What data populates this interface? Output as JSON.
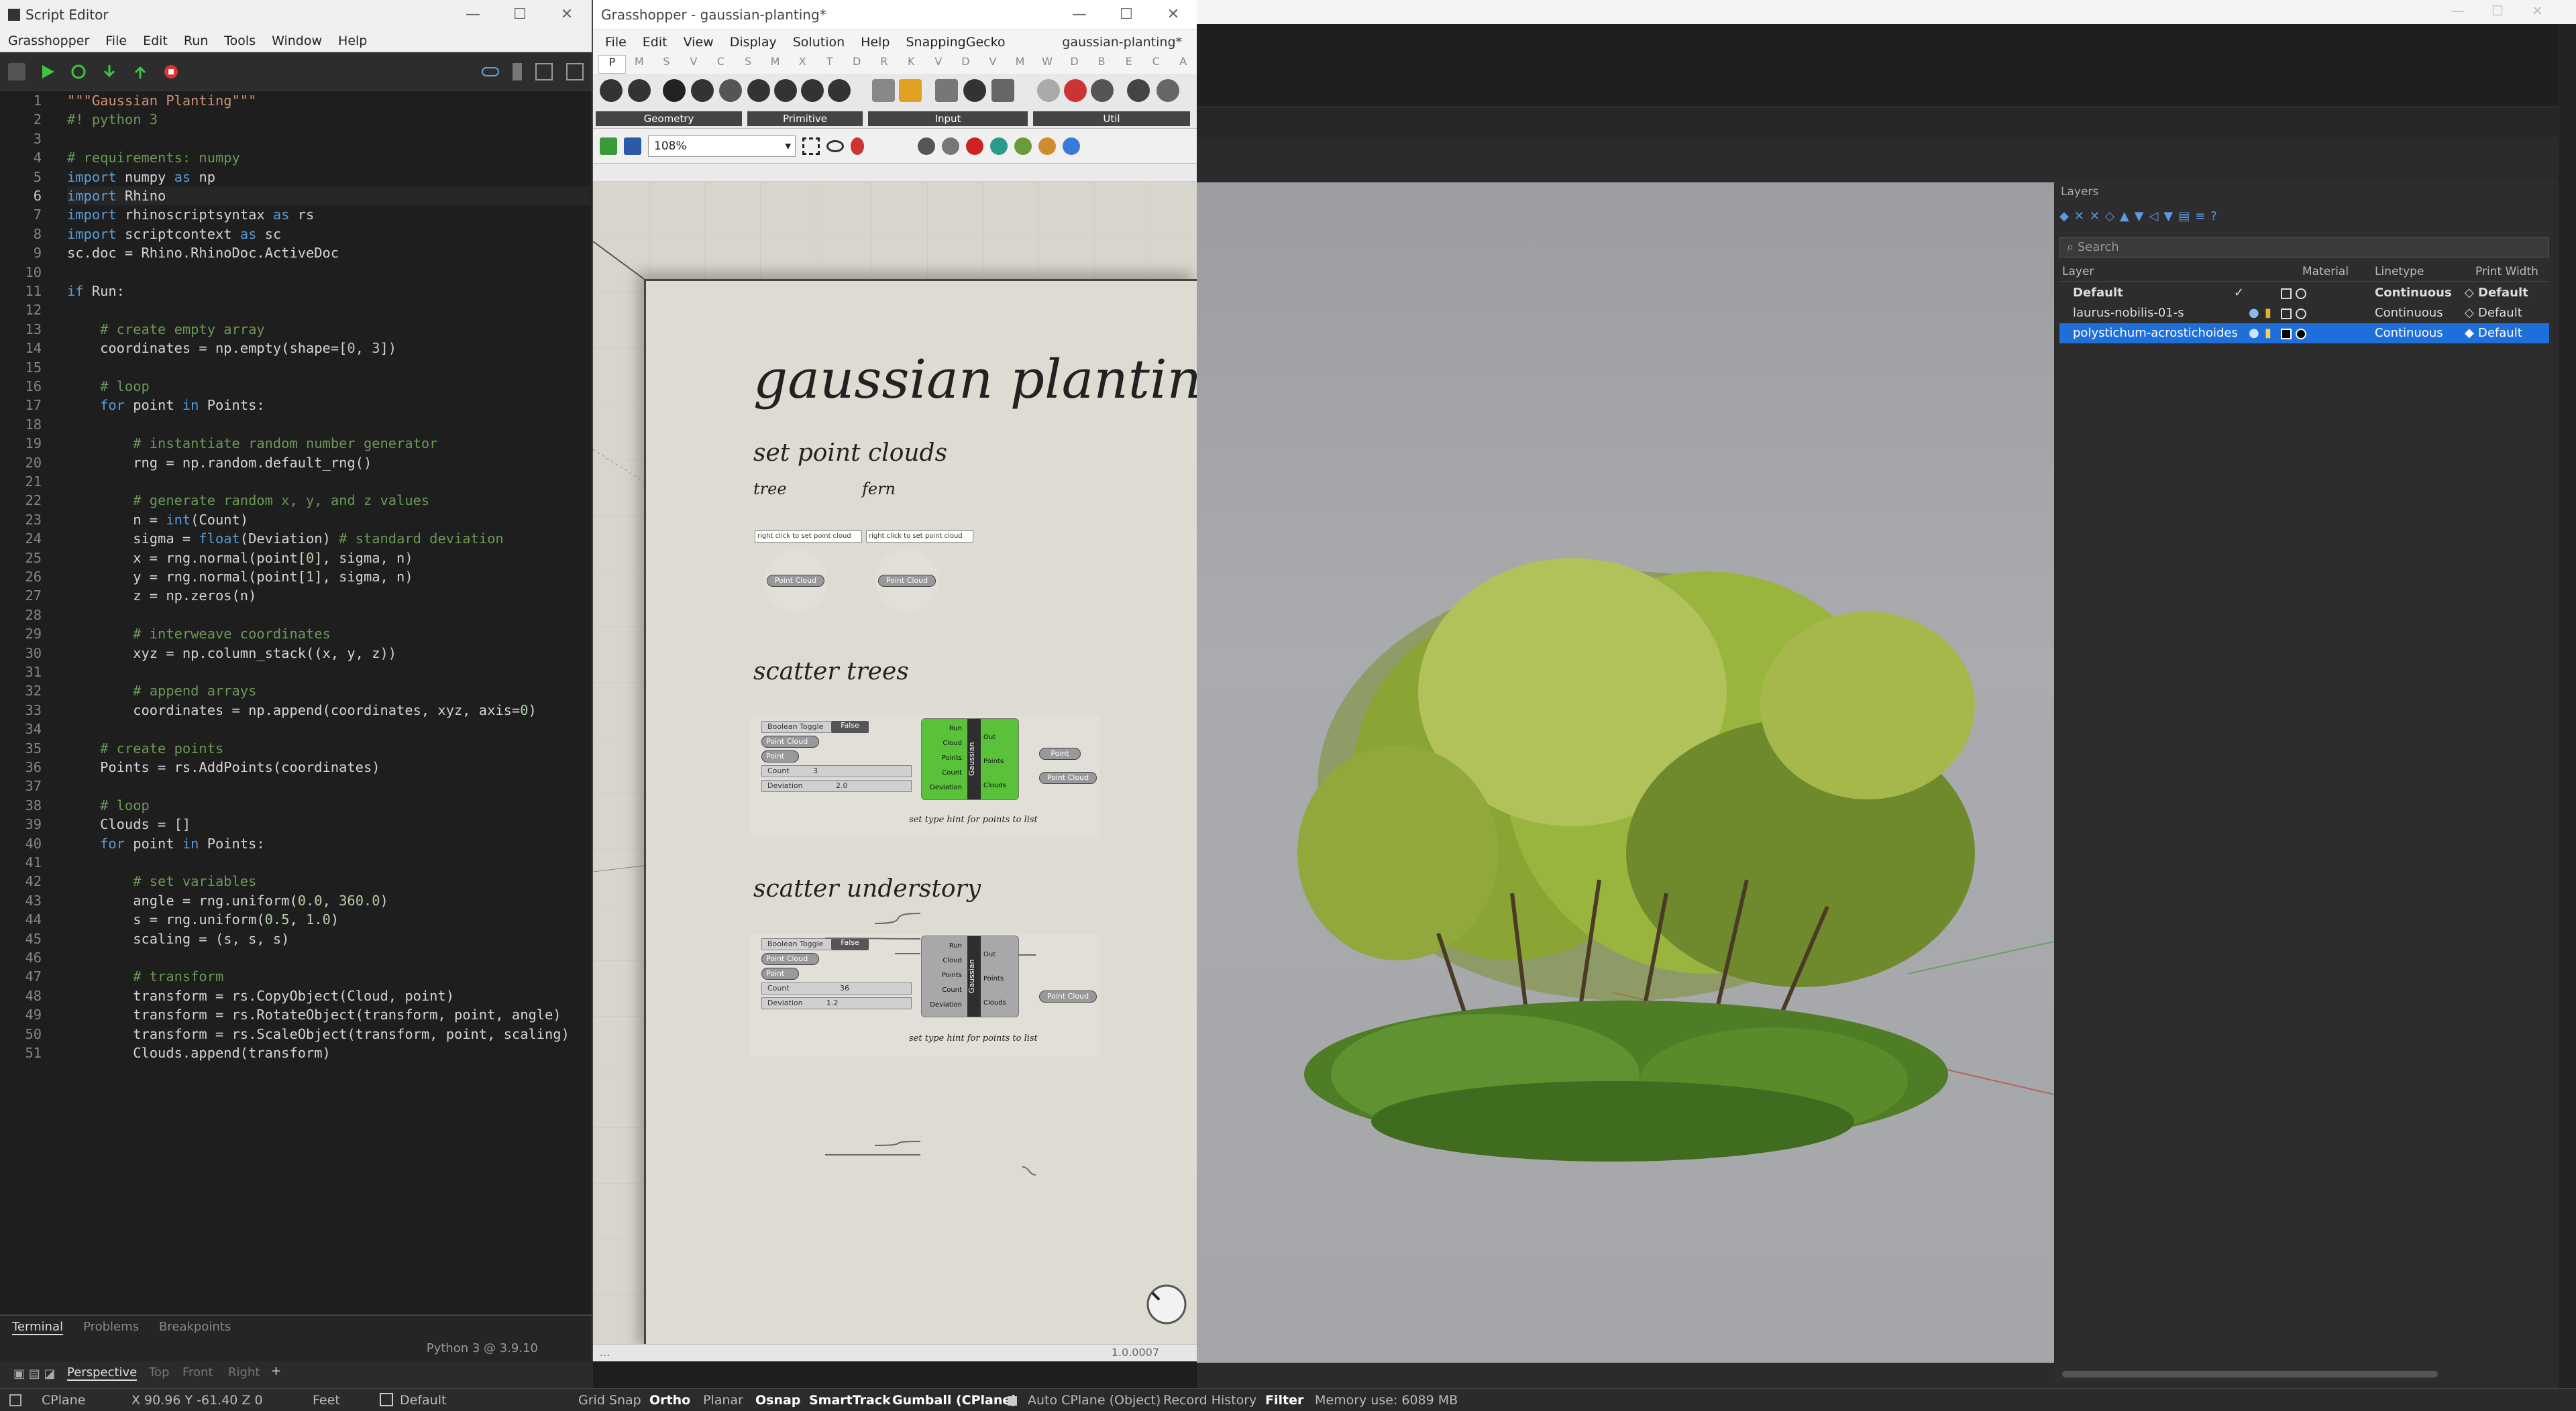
{
  "script_editor": {
    "title": "Script Editor",
    "menu": [
      "Grasshopper",
      "File",
      "Edit",
      "Run",
      "Tools",
      "Window",
      "Help"
    ],
    "code_lines": [
      "\"\"\"Gaussian Planting\"\"\"",
      "#! python 3",
      "",
      "# requirements: numpy",
      "import numpy as np",
      "import Rhino",
      "import rhinoscriptsyntax as rs",
      "import scriptcontext as sc",
      "sc.doc = Rhino.RhinoDoc.ActiveDoc",
      "",
      "if Run:",
      "",
      "    # create empty array",
      "    coordinates = np.empty(shape=[0, 3])",
      "",
      "    # loop",
      "    for point in Points:",
      "",
      "        # instantiate random number generator",
      "        rng = np.random.default_rng()",
      "",
      "        # generate random x, y, and z values",
      "        n = int(Count)",
      "        sigma = float(Deviation) # standard deviation",
      "        x = rng.normal(point[0], sigma, n)",
      "        y = rng.normal(point[1], sigma, n)",
      "        z = np.zeros(n)",
      "",
      "        # interweave coordinates",
      "        xyz = np.column_stack((x, y, z))",
      "",
      "        # append arrays",
      "        coordinates = np.append(coordinates, xyz, axis=0)",
      "",
      "    # create points",
      "    Points = rs.AddPoints(coordinates)",
      "",
      "    # loop",
      "    Clouds = []",
      "    for point in Points:",
      "",
      "        # set variables",
      "        angle = rng.uniform(0.0, 360.0)",
      "        s = rng.uniform(0.5, 1.0)",
      "        scaling = (s, s, s)",
      "",
      "        # transform",
      "        transform = rs.CopyObject(Cloud, point)",
      "        transform = rs.RotateObject(transform, point, angle)",
      "        transform = rs.ScaleObject(transform, point, scaling)",
      "        Clouds.append(transform)"
    ],
    "current_line": 6,
    "bottom_tabs": [
      "Terminal",
      "Problems",
      "Breakpoints"
    ],
    "python_version": "Python 3 @ 3.9.10"
  },
  "grasshopper": {
    "title": "Grasshopper - gaussian-planting*",
    "doc_name": "gaussian-planting*",
    "menu": [
      "File",
      "Edit",
      "View",
      "Display",
      "Solution",
      "Help",
      "SnappingGecko"
    ],
    "categories": [
      "P",
      "M",
      "S",
      "V",
      "C",
      "S",
      "M",
      "X",
      "T",
      "D",
      "R",
      "K",
      "V",
      "D",
      "V",
      "M",
      "W",
      "D",
      "B",
      "E",
      "C",
      "A"
    ],
    "ribbon_groups": [
      "Geometry",
      "Primitive",
      "Input",
      "Util"
    ],
    "zoom": "108%",
    "canvas": {
      "title": "gaussian planting",
      "section1": "set point clouds",
      "tree_label": "tree",
      "fern_label": "fern",
      "panel_hint": "right click to set point cloud",
      "point_cloud_param": "Point Cloud",
      "section2": "scatter trees",
      "section3": "scatter understory",
      "boolean_toggle": "Boolean Toggle",
      "toggle_value": "False",
      "input_point_cloud": "Point Cloud",
      "input_point": "Point",
      "input_count": "Count",
      "input_deviation": "Deviation",
      "count1": "3",
      "dev1": "2.0",
      "count2": "36",
      "dev2": "1.2",
      "comp_inputs": [
        "Run",
        "Cloud",
        "Points",
        "Count",
        "Deviation"
      ],
      "comp_outputs": [
        "Out",
        "Points",
        "Clouds"
      ],
      "comp_name": "Gaussian",
      "out_point": "Point",
      "out_cloud": "Point Cloud",
      "type_hint": "set type hint for points to list"
    },
    "version": "1.0.0007",
    "status_left": "..."
  },
  "rhino": {
    "layers_title": "Layers",
    "search_placeholder": "Search",
    "columns": [
      "Layer",
      "Material",
      "Linetype",
      "Print Width"
    ],
    "layers": [
      {
        "name": "Default",
        "linetype": "Continuous",
        "print_width": "Default"
      },
      {
        "name": "laurus-nobilis-01-s",
        "linetype": "Continuous",
        "print_width": "Default"
      },
      {
        "name": "polystichum-acrostichoides",
        "linetype": "Continuous",
        "print_width": "Default"
      }
    ],
    "viewport_tabs": [
      "Perspective",
      "Top",
      "Front",
      "Right"
    ],
    "status": {
      "cplane": "CPlane",
      "coords": "X 90.96 Y -61.40 Z 0",
      "units": "Feet",
      "layer": "Default",
      "grid_snap": "Grid Snap",
      "ortho": "Ortho",
      "planar": "Planar",
      "osnap": "Osnap",
      "smarttrack": "SmartTrack",
      "gumball": "Gumball (CPlane)",
      "auto_cplane": "Auto CPlane (Object)",
      "record_history": "Record History",
      "filter": "Filter",
      "memory": "Memory use: 6089 MB"
    },
    "colors": {
      "selection": "#1e6fd9",
      "foliage": "#6c8f2a"
    }
  }
}
